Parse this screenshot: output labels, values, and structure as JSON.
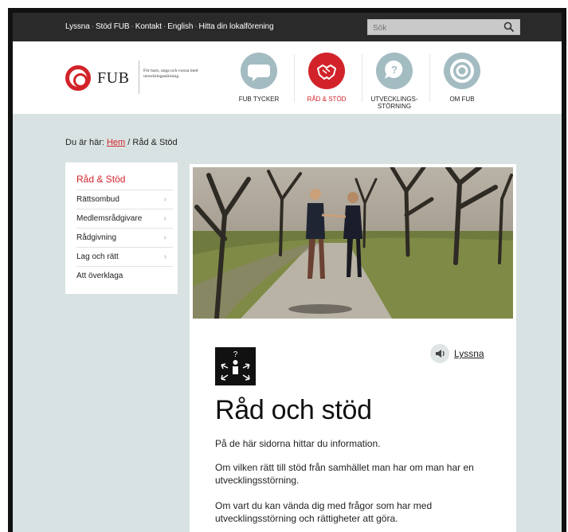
{
  "topbar": {
    "links": [
      "Lyssna",
      "Stöd FUB",
      "Kontakt",
      "English",
      "Hitta din lokalförening"
    ],
    "separator": "·",
    "search_placeholder": "Sök"
  },
  "logo": {
    "name": "FUB",
    "tagline": "För barn, unga och vuxna med utvecklingsstörning"
  },
  "nav": [
    {
      "label": "FUB TYCKER",
      "icon": "speech-bubble-icon"
    },
    {
      "label": "RÅD & STÖD",
      "icon": "handshake-icon",
      "active": true
    },
    {
      "label": "UTVECKLINGS-STÖRNING",
      "icon": "question-bubble-icon"
    },
    {
      "label": "OM FUB",
      "icon": "fub-ring-icon"
    }
  ],
  "breadcrumb": {
    "prefix": "Du är här:",
    "home": "Hem",
    "separator": "/",
    "current": "Råd & Stöd"
  },
  "sidemenu": {
    "title": "Råd & Stöd",
    "items": [
      "Rättsombud",
      "Medlemsrådgivare",
      "Rådgivning",
      "Lag och rätt",
      "Att överklaga"
    ],
    "chevron": "›"
  },
  "content": {
    "listen_label": "Lyssna",
    "heading": "Råd och stöd",
    "paragraphs": [
      "På de här sidorna hittar du information.",
      "Om vilken rätt till stöd från samhället man har om man har en utvecklingsstörning.",
      "Om vart du kan vända dig med frågor som har med utvecklingsstörning och rättigheter att göra."
    ]
  },
  "colors": {
    "brand_red": "#d2232a",
    "nav_circle": "#a3bcc2",
    "page_bg": "#d9e2e2",
    "topbar_bg": "#2a2a2a"
  }
}
